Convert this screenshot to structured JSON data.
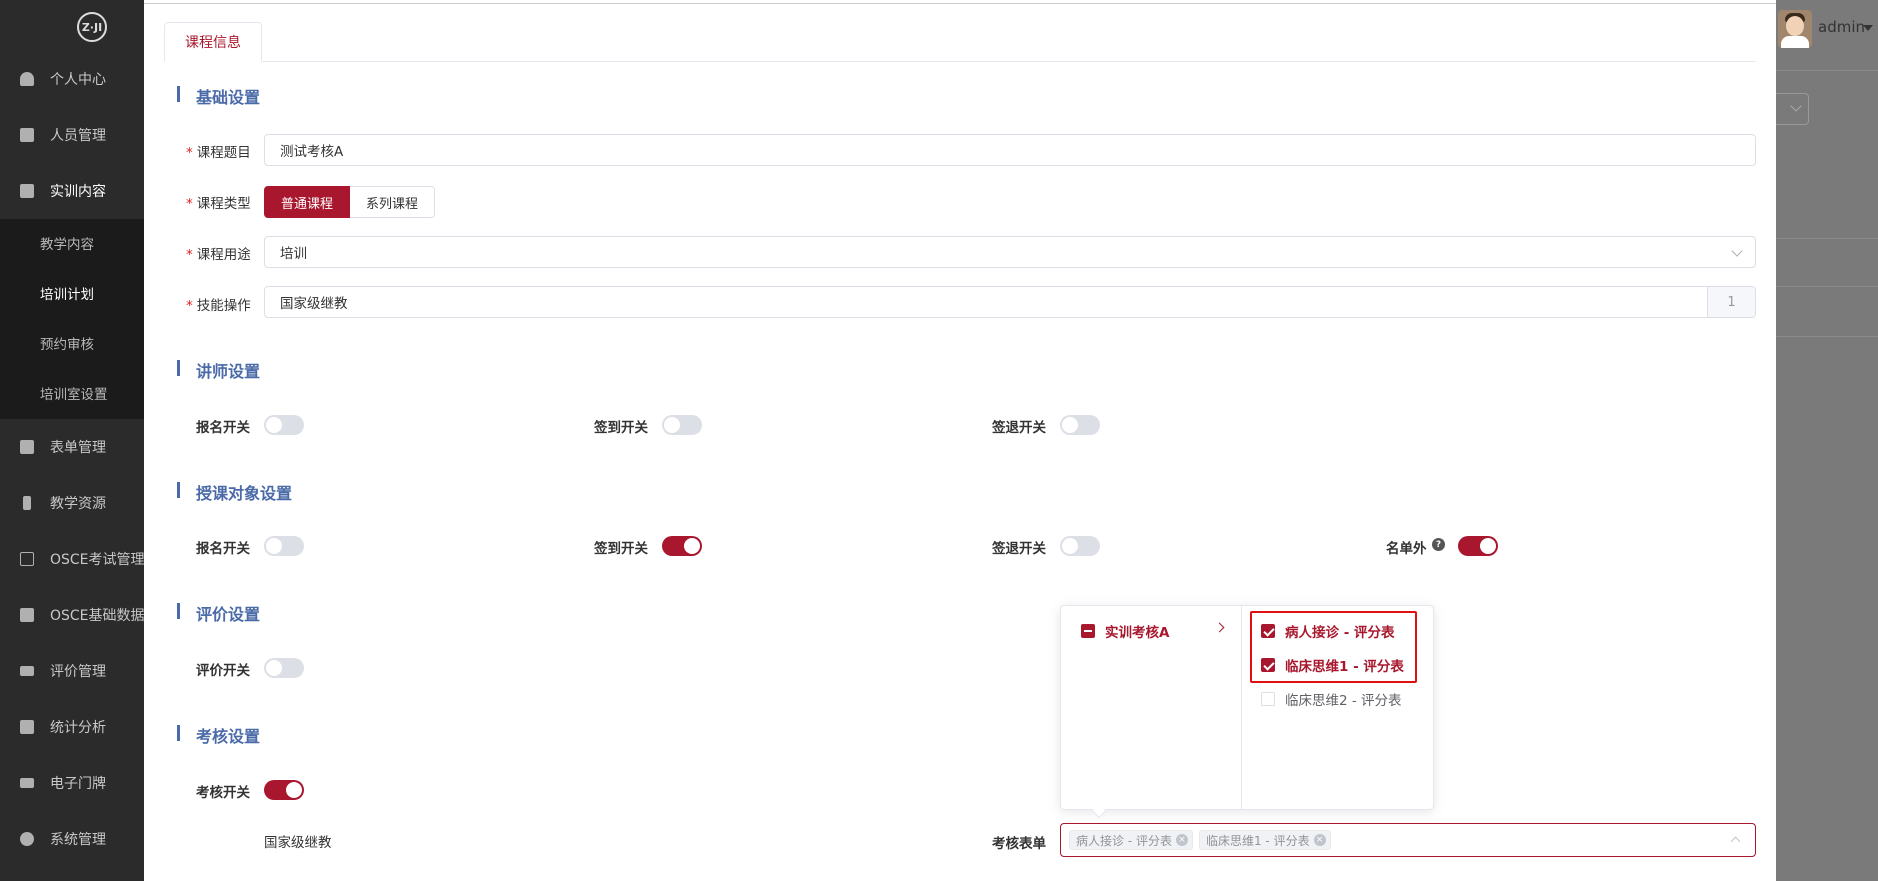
{
  "sidebar": {
    "logo_text": "Z·JI",
    "items": [
      {
        "label": "个人中心",
        "icon": "user-icon"
      },
      {
        "label": "人员管理",
        "icon": "users-icon"
      },
      {
        "label": "实训内容",
        "icon": "book-icon"
      },
      {
        "label": "表单管理",
        "icon": "form-icon"
      },
      {
        "label": "教学资源",
        "icon": "resource-icon"
      },
      {
        "label": "OSCE考试管理",
        "icon": "exam-icon"
      },
      {
        "label": "OSCE基础数据",
        "icon": "grid-icon"
      },
      {
        "label": "评价管理",
        "icon": "evaluation-icon"
      },
      {
        "label": "统计分析",
        "icon": "bar-chart-icon"
      },
      {
        "label": "电子门牌",
        "icon": "monitor-icon"
      },
      {
        "label": "系统管理",
        "icon": "gear-icon"
      }
    ],
    "submenu": [
      "教学内容",
      "培训计划",
      "预约审核",
      "培训室设置"
    ],
    "active_sub": "培训计划"
  },
  "header": {
    "user": "admin"
  },
  "tabs": [
    {
      "label": "课程信息"
    }
  ],
  "basic": {
    "title": "基础设置",
    "course_title_label": "课程题目",
    "course_title_value": "测试考核A",
    "course_type_label": "课程类型",
    "course_type_options": [
      "普通课程",
      "系列课程"
    ],
    "course_type_selected": "普通课程",
    "purpose_label": "课程用途",
    "purpose_value": "培训",
    "skill_label": "技能操作",
    "skill_value": "国家级继教",
    "skill_count": "1"
  },
  "lecturer": {
    "title": "讲师设置",
    "signup_label": "报名开关",
    "signup_on": false,
    "checkin_label": "签到开关",
    "checkin_on": false,
    "checkout_label": "签退开关",
    "checkout_on": false
  },
  "audience": {
    "title": "授课对象设置",
    "signup_label": "报名开关",
    "signup_on": false,
    "checkin_label": "签到开关",
    "checkin_on": true,
    "checkout_label": "签退开关",
    "checkout_on": false,
    "outlist_label": "名单外",
    "outlist_on": true
  },
  "evaluation": {
    "title": "评价设置",
    "switch_label": "评价开关",
    "switch_on": false
  },
  "assessment": {
    "title": "考核设置",
    "switch_label": "考核开关",
    "switch_on": true,
    "skill_text": "国家级继教",
    "form_label": "考核表单",
    "cascader": {
      "parent": "实训考核A",
      "children": [
        {
          "label": "病人接诊 - 评分表",
          "checked": true
        },
        {
          "label": "临床思维1 - 评分表",
          "checked": true
        },
        {
          "label": "临床思维2 - 评分表",
          "checked": false
        }
      ]
    },
    "tags": [
      "病人接诊 - 评分表",
      "临床思维1 - 评分表"
    ]
  },
  "colors": {
    "primary": "#a8172d",
    "section": "#4a6aa8",
    "sidebar": "#2b2b2b"
  }
}
